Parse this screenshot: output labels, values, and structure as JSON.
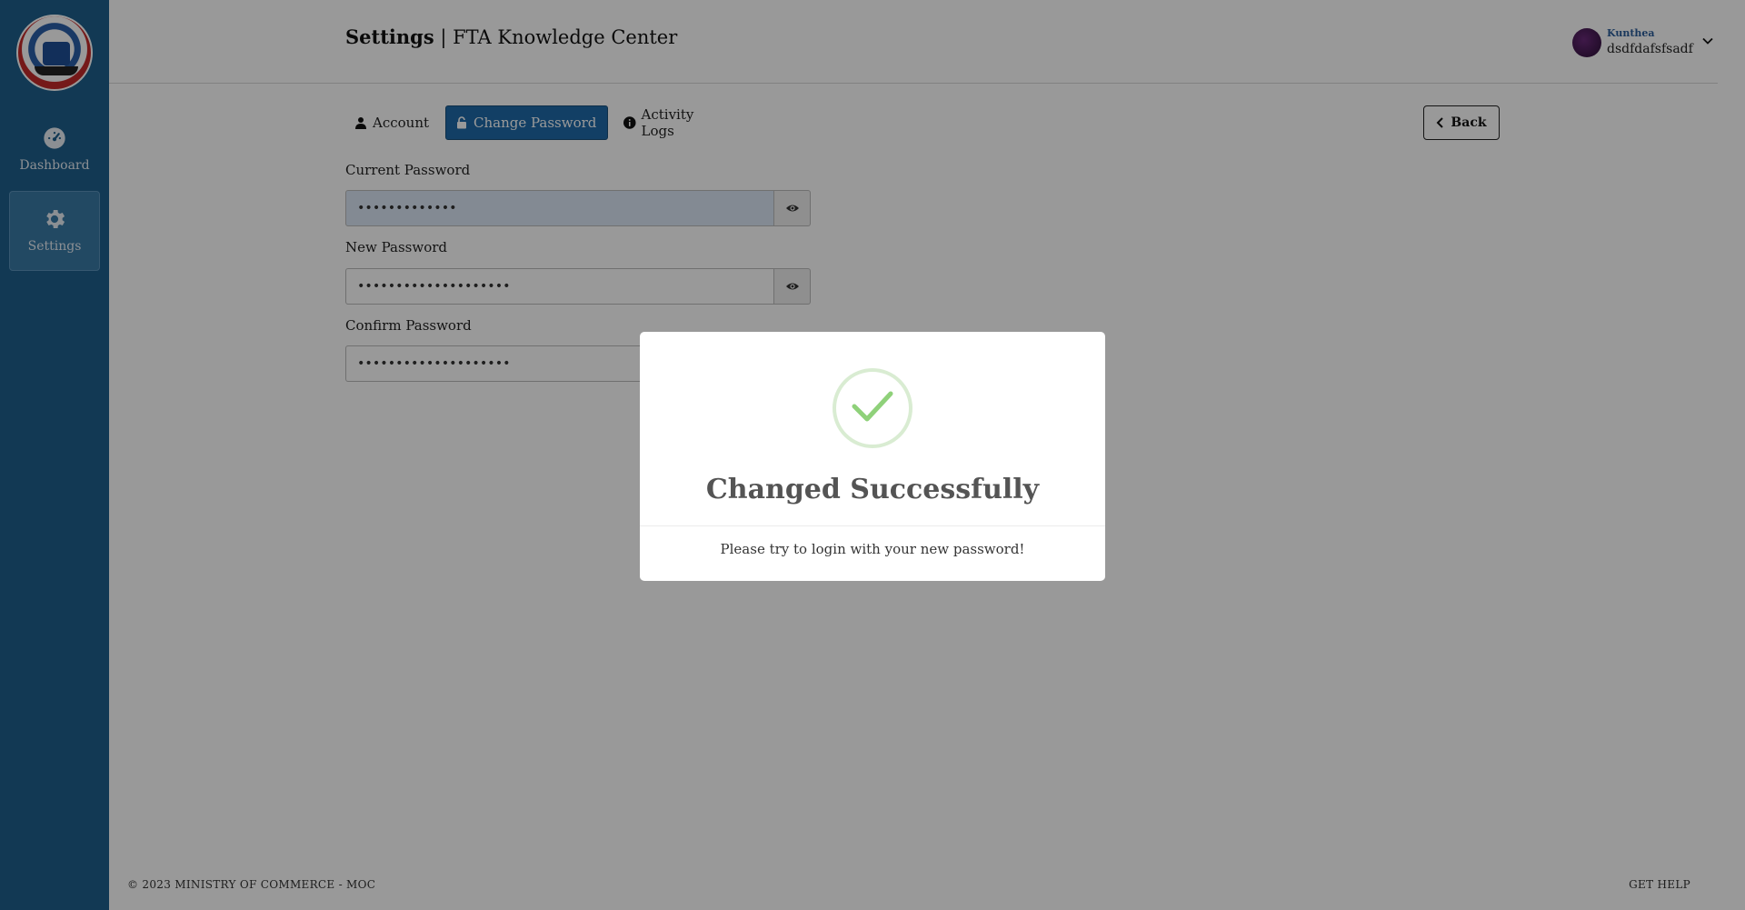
{
  "sidebar": {
    "logo": "ministry-of-commerce-logo",
    "items": [
      {
        "label": "Dashboard",
        "icon": "gauge-icon"
      },
      {
        "label": "Settings",
        "icon": "gear-icon"
      }
    ]
  },
  "header": {
    "title_bold": "Settings",
    "title_rest": " | FTA Knowledge Center",
    "user_name": "Kunthea",
    "user_handle": "dsdfdafsfsadf"
  },
  "tabs": [
    {
      "label": "Account",
      "icon": "user-icon",
      "active": false
    },
    {
      "label": "Change Password",
      "icon": "lock-icon",
      "active": true
    },
    {
      "label": "Activity Logs",
      "icon": "info-icon",
      "active": false
    }
  ],
  "back_label": "Back",
  "form": {
    "current_label": "Current Password",
    "current_value": "•••••••••••••",
    "new_label": "New Password",
    "new_value": "••••••••••••••••••••",
    "confirm_label": "Confirm Password",
    "confirm_value": "••••••••••••••••••••"
  },
  "footer": {
    "copyright": "© 2023 MINISTRY OF COMMERCE - MOC",
    "help": "GET HELP"
  },
  "modal": {
    "icon": "success-check-icon",
    "title": "Changed Successfully",
    "message": "Please try to login with your new password!"
  },
  "colors": {
    "sidebar": "#1e5f8c",
    "accent": "#1e6aa8",
    "success": "#8fd17a"
  }
}
